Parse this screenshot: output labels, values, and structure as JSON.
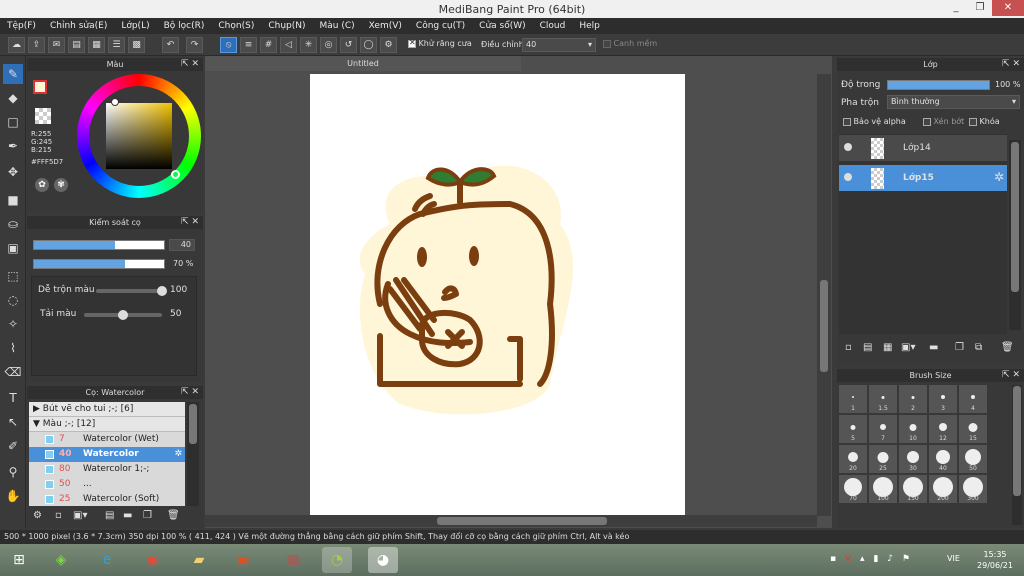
{
  "window": {
    "title": "MediBang Paint Pro (64bit)",
    "min": "_",
    "restore": "❐",
    "close": "✕"
  },
  "menu": [
    "Tệp(F)",
    "Chỉnh sửa(E)",
    "Lớp(L)",
    "Bộ lọc(R)",
    "Chọn(S)",
    "Chụp(N)",
    "Màu (C)",
    "Xem(V)",
    "Công cụ(T)",
    "Cửa sổ(W)",
    "Cloud",
    "Help"
  ],
  "toolbar": {
    "antialias_label": "Khử răng cưa",
    "adjust_label": "Điều chỉnh",
    "adjust_value": "40",
    "edge_label": "Canh mềm"
  },
  "color_panel": {
    "title": "Màu",
    "r": "R:255",
    "g": "G:245",
    "b": "B:215",
    "hex": "#FFF5D7",
    "primary": "#FFF5D7",
    "secondary": "#9ab5e0"
  },
  "brush_control": {
    "title": "Kiểm soát cọ",
    "size_value": "40",
    "size_fraction": 0.62,
    "opacity_value": "70 %",
    "opacity_fraction": 0.7,
    "blend_label": "Dễ trộn màu",
    "blend_value": "100",
    "blend_fraction": 1.0,
    "amount_label": "Tải màu",
    "amount_value": "50",
    "amount_fraction": 0.5
  },
  "brush_list": {
    "title": "Cọ: Watercolor",
    "groups": [
      {
        "label": "Bút vẽ cho tui ;-; [6]",
        "expanded": false
      },
      {
        "label": "Màu ;-; [12]",
        "expanded": true
      }
    ],
    "items": [
      {
        "size": "7",
        "name": "Watercolor (Wet)",
        "selected": false
      },
      {
        "size": "40",
        "name": "Watercolor",
        "selected": true
      },
      {
        "size": "80",
        "name": "Watercolor 1;-;",
        "selected": false
      },
      {
        "size": "50",
        "name": "...",
        "selected": false
      },
      {
        "size": "25",
        "name": "Watercolor (Soft)",
        "selected": false
      }
    ]
  },
  "canvas": {
    "tab": "Untitled"
  },
  "layer_panel": {
    "title": "Lớp",
    "opacity_label": "Độ trong",
    "opacity_value": "100 %",
    "blend_label": "Pha trộn",
    "blend_value": "Bình thường",
    "alpha_label": "Bảo vệ alpha",
    "clip_label": "Xén bớt",
    "lock_label": "Khóa",
    "layers": [
      {
        "name": "Lớp14",
        "selected": false
      },
      {
        "name": "Lớp15",
        "selected": true
      }
    ]
  },
  "brush_size": {
    "title": "Brush Size",
    "sizes": [
      "1",
      "1.5",
      "2",
      "3",
      "4",
      "5",
      "7",
      "10",
      "12",
      "15",
      "20",
      "25",
      "30",
      "40",
      "50",
      "70",
      "100",
      "150",
      "200",
      "300"
    ]
  },
  "status": {
    "text": "500 * 1000 pixel   (3.6 * 7.3cm)   350 dpi   100 %   ( 411, 424 )   Vẽ một đường thẳng bằng cách giữ phím Shift, Thay đổi cỡ cọ bằng cách giữ phím Ctrl, Alt và kéo"
  },
  "taskbar": {
    "lang": "VIE",
    "time": "15:35",
    "date": "29/06/21"
  },
  "colors": {
    "accent": "#4a90d9",
    "drawing_stroke": "#7a3e0f",
    "drawing_fill": "#FFF5D7",
    "leaf": "#2e7d32"
  }
}
